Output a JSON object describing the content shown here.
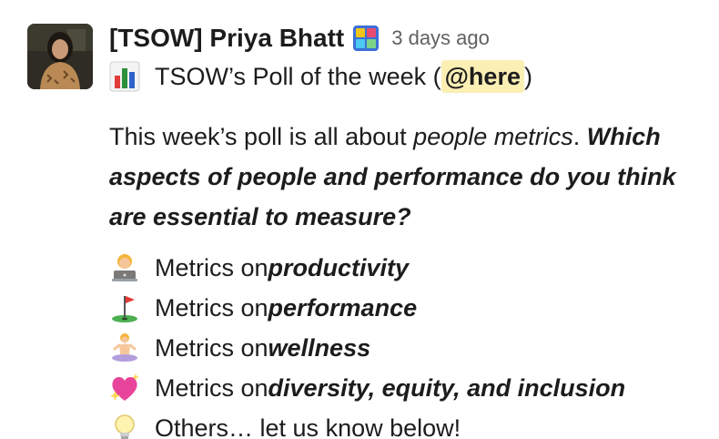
{
  "message": {
    "author": "[TSOW] Priya Bhatt",
    "author_status_icon": "colorful-grid-icon",
    "timestamp": "3 days ago",
    "title": {
      "icon": "bar-chart-icon",
      "text_before": "TSOW’s Poll of the week (",
      "mention": "@here",
      "text_after": ")"
    },
    "body": {
      "intro": "This week’s poll is all about ",
      "intro_em": "people metrics",
      "intro_period": ". ",
      "question": "Which aspects of people and performance do you think are essential to measure?"
    },
    "options": [
      {
        "icon": "person-technologist-icon",
        "prefix": "Metrics on ",
        "emphasis": "productivity"
      },
      {
        "icon": "golf-flag-icon",
        "prefix": "Metrics on ",
        "emphasis": "performance"
      },
      {
        "icon": "person-lotus-position-icon",
        "prefix": "Metrics on ",
        "emphasis": "wellness"
      },
      {
        "icon": "sparkling-heart-icon",
        "prefix": "Metrics on ",
        "emphasis": "diversity, equity, and inclusion"
      },
      {
        "icon": "light-bulb-icon",
        "prefix": "Others… let us know below!",
        "emphasis": ""
      }
    ]
  },
  "colors": {
    "text": "#1d1c1d",
    "muted": "#616061",
    "mention_bg": "#fcefb4"
  }
}
